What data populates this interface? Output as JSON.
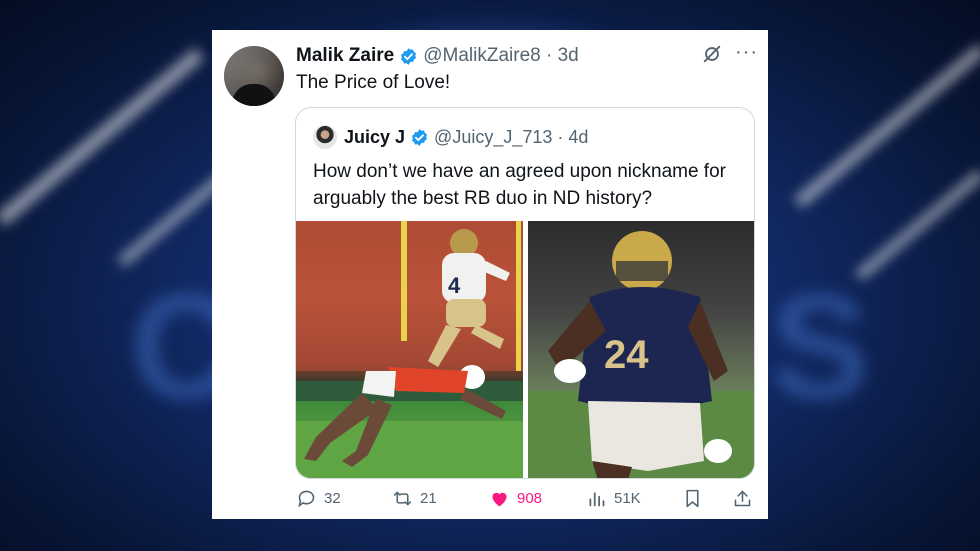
{
  "tweet": {
    "author_name": "Malik Zaire",
    "handle_time": "@MalikZaire8 · 3d",
    "text": "The Price of Love!"
  },
  "quoted_tweet": {
    "author_name": "Juicy J",
    "handle_time": "@Juicy_J_713 · 4d",
    "text": "How don’t we have an agreed upon nickname for arguably the best RB duo in ND history?",
    "media_left": {
      "jersey_number": "4"
    },
    "media_right": {
      "jersey_number": "24"
    }
  },
  "actions": {
    "replies": "32",
    "retweets": "21",
    "likes": "908",
    "views": "51K"
  },
  "colors": {
    "verified": "#1d9bf0",
    "like": "#f91880",
    "secondary_text": "#536471",
    "background": "#122a66"
  },
  "icons": [
    "verified-icon",
    "grok-icon",
    "more-icon",
    "reply-icon",
    "retweet-icon",
    "like-icon",
    "views-icon",
    "bookmark-icon",
    "share-icon"
  ]
}
